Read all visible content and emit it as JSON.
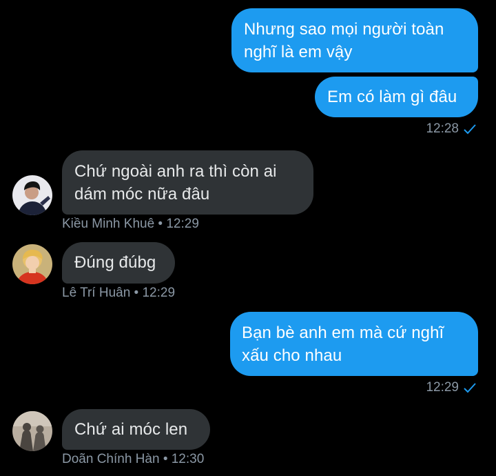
{
  "colors": {
    "outgoing_bubble": "#1d9bf0",
    "incoming_bubble": "#2f3336",
    "meta_text": "#8b98a5",
    "read_check": "#1d9bf0",
    "background": "#000000"
  },
  "messages": [
    {
      "direction": "out",
      "text": "Nhưng sao mọi người toàn\nnghĩ là em vậy"
    },
    {
      "direction": "out",
      "text": "Em có làm gì đâu",
      "time": "12:28",
      "status_icon": "check-icon"
    },
    {
      "direction": "in",
      "text": "Chứ ngoài anh ra thì còn ai\ndám móc nữa đâu",
      "sender": "Kiều Minh Khuê",
      "time": "12:29",
      "meta": "Kiều Minh Khuê • 12:29",
      "avatar_icon": "avatar-kieu-minh-khue"
    },
    {
      "direction": "in",
      "text": "Đúng đúbg",
      "sender": "Lê Trí Huân",
      "time": "12:29",
      "meta": "Lê Trí Huân • 12:29",
      "avatar_icon": "avatar-le-tri-huan"
    },
    {
      "direction": "out",
      "text": "Bạn bè anh em mà cứ nghĩ\nxấu cho nhau",
      "time": "12:29",
      "status_icon": "check-icon"
    },
    {
      "direction": "in",
      "text": "Chứ ai móc len",
      "sender": "Doãn Chính Hàn",
      "time": "12:30",
      "meta": "Doãn Chính Hàn • 12:30",
      "avatar_icon": "avatar-doan-chinh-han"
    }
  ]
}
